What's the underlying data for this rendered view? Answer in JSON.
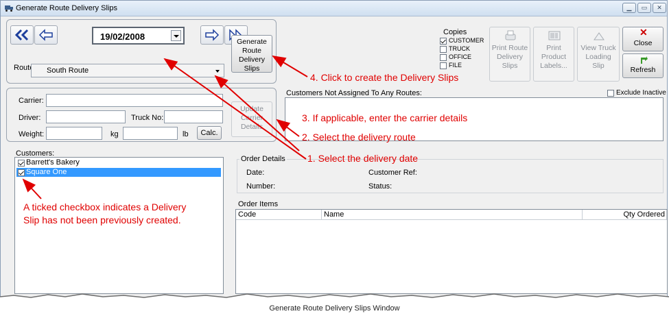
{
  "window": {
    "title": "Generate Route Delivery Slips",
    "controls": [
      "minimize",
      "maximize",
      "close"
    ]
  },
  "navigation": {
    "date": "19/02/2008",
    "route_label": "Route:",
    "route_value": "South Route",
    "generate_button": [
      "Generate",
      "Route",
      "Delivery",
      "Slips"
    ]
  },
  "copies": {
    "title": "Copies",
    "options": [
      {
        "label": "CUSTOMER",
        "checked": true
      },
      {
        "label": "TRUCK",
        "checked": false
      },
      {
        "label": "OFFICE",
        "checked": false
      },
      {
        "label": "FILE",
        "checked": false
      }
    ]
  },
  "toolbar": {
    "print_route_slips": [
      "Print Route",
      "Delivery",
      "Slips"
    ],
    "print_product_labels": [
      "Print",
      "Product",
      "Labels..."
    ],
    "view_truck_loading_slip": [
      "View Truck",
      "Loading",
      "Slip"
    ],
    "close_label": "Close",
    "refresh_label": "Refresh"
  },
  "carrier": {
    "carrier_label": "Carrier:",
    "driver_label": "Driver:",
    "truck_no_label": "Truck No:",
    "weight_label": "Weight:",
    "kg_unit": "kg",
    "lb_unit": "lb",
    "calc_button": "Calc.",
    "update_button": [
      "Update",
      "Carrier",
      "Details"
    ]
  },
  "unassigned": {
    "heading": "Customers Not Assigned To Any Routes:",
    "exclude_inactive": "Exclude Inactive"
  },
  "customers": {
    "heading": "Customers:",
    "items": [
      {
        "name": "Barrett's Bakery",
        "checked": true,
        "selected": false
      },
      {
        "name": "Square One",
        "checked": true,
        "selected": true
      }
    ]
  },
  "order_details": {
    "heading": "Order Details",
    "date_label": "Date:",
    "number_label": "Number:",
    "customer_ref_label": "Customer Ref:",
    "status_label": "Status:"
  },
  "order_items": {
    "heading": "Order Items",
    "columns": [
      "Code",
      "Name",
      "Qty Ordered"
    ]
  },
  "annotations": {
    "step4": "4. Click to create the Delivery Slips",
    "step3": "3. If applicable, enter the carrier details",
    "step2": "2. Select the delivery route",
    "step1": "1. Select the delivery date",
    "checkbox_note_line1": "A ticked checkbox indicates a Delivery",
    "checkbox_note_line2": "Slip has not been previously created."
  },
  "caption": "Generate Route Delivery Slips Window",
  "colors": {
    "annotation": "#e00000",
    "selection": "#3399ff",
    "close_icon": "#cc0000",
    "refresh_icon": "#3a9a2a"
  }
}
